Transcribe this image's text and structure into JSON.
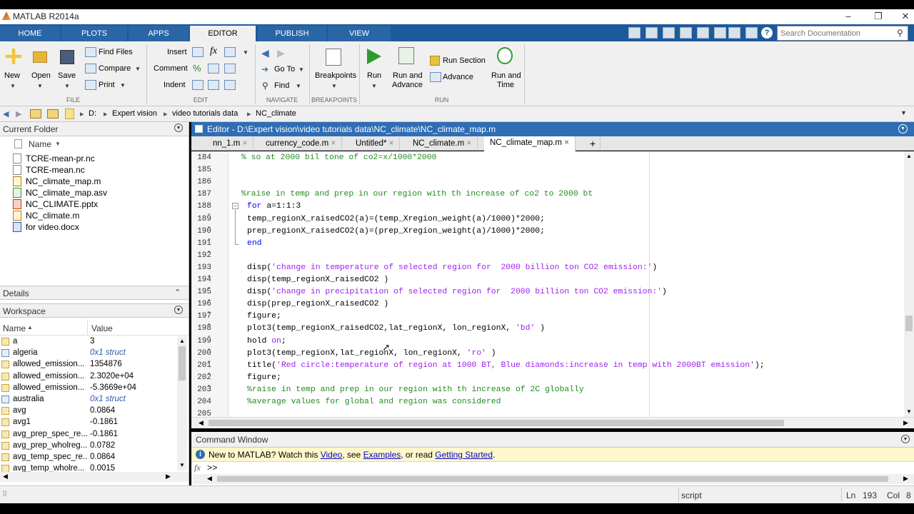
{
  "window": {
    "title": "MATLAB R2014a"
  },
  "tabs": [
    "HOME",
    "PLOTS",
    "APPS",
    "EDITOR",
    "PUBLISH",
    "VIEW"
  ],
  "search": {
    "placeholder": "Search Documentation"
  },
  "ribbon": {
    "file": {
      "new": "New",
      "open": "Open",
      "save": "Save",
      "find_files": "Find Files",
      "compare": "Compare",
      "print": "Print",
      "section": "FILE"
    },
    "edit": {
      "insert": "Insert",
      "comment": "Comment",
      "indent": "Indent",
      "fx": "fx",
      "section": "EDIT"
    },
    "navigate": {
      "go_to": "Go To",
      "find": "Find",
      "section": "NAVIGATE"
    },
    "breakpoints": {
      "label": "Breakpoints",
      "section": "BREAKPOINTS"
    },
    "run": {
      "run": "Run",
      "run_and_advance_1": "Run and",
      "run_and_advance_2": "Advance",
      "run_section": "Run Section",
      "advance": "Advance",
      "run_and_time_1": "Run and",
      "run_and_time_2": "Time",
      "section": "RUN"
    }
  },
  "address": {
    "path": [
      "D:",
      "Expert vision",
      "video tutorials data",
      "NC_climate"
    ]
  },
  "current_folder": {
    "title": "Current Folder",
    "column": "Name",
    "files": [
      "TCRE-mean-pr.nc",
      "TCRE-mean.nc",
      "NC_climate_map.m",
      "NC_climate_map.asv",
      "NC_CLIMATE.pptx",
      "NC_climate.m",
      "for video.docx"
    ]
  },
  "details": {
    "title": "Details"
  },
  "workspace": {
    "title": "Workspace",
    "col_name": "Name",
    "col_value": "Value",
    "rows": [
      {
        "name": "a",
        "value": "3"
      },
      {
        "name": "algeria",
        "value": "0x1 struct"
      },
      {
        "name": "allowed_emission...",
        "value": "1354876"
      },
      {
        "name": "allowed_emission...",
        "value": "2.3020e+04"
      },
      {
        "name": "allowed_emission...",
        "value": "-5.3669e+04"
      },
      {
        "name": "australia",
        "value": "0x1 struct"
      },
      {
        "name": "avg",
        "value": "0.0864"
      },
      {
        "name": "avg1",
        "value": "-0.1861"
      },
      {
        "name": "avg_prep_spec_re...",
        "value": "-0.1861"
      },
      {
        "name": "avg_prep_wholreg...",
        "value": "0.0782"
      },
      {
        "name": "avg_temp_spec_re...",
        "value": "0.0864"
      },
      {
        "name": "avg_temp_wholre...",
        "value": "0.0015"
      }
    ]
  },
  "editor": {
    "title": "Editor - D:\\Expert vision\\video tutorials data\\NC_climate\\NC_climate_map.m",
    "tabs": [
      "nn_1.m",
      "currency_code.m",
      "Untitled*",
      "NC_climate.m",
      "NC_climate_map.m"
    ],
    "add_tab": "+",
    "lines": [
      {
        "n": "184",
        "t": "% so at 2000 bil tone of co2=x/1000*2000",
        "c": "cm",
        "i": 0
      },
      {
        "n": "185",
        "t": "",
        "c": "",
        "i": 0
      },
      {
        "n": "186",
        "t": "",
        "c": "",
        "i": 0
      },
      {
        "n": "187",
        "t": "%raise in temp and prep in our region with th increase of co2 to 2000 bt",
        "c": "cm",
        "i": 0
      },
      {
        "n": "188 -",
        "t": "for a=1:1:3",
        "c": "for",
        "i": 1
      },
      {
        "n": "189 -",
        "t": "temp_regionX_raisedCO2(a)=(temp_Xregion_weight(a)/1000)*2000;",
        "c": "",
        "i": 1
      },
      {
        "n": "190 -",
        "t": "prep_regionX_raisedCO2(a)=(prep_Xregion_weight(a)/1000)*2000;",
        "c": "",
        "i": 1
      },
      {
        "n": "191 -",
        "t": "end",
        "c": "kw",
        "i": 1
      },
      {
        "n": "192",
        "t": "",
        "c": "",
        "i": 0
      },
      {
        "n": "193 -",
        "t": "disp('change in temperature of selected region for  2000 billion ton CO2 emission:')",
        "c": "str",
        "i": 1
      },
      {
        "n": "194 -",
        "t": "disp(temp_regionX_raisedCO2 )",
        "c": "",
        "i": 1
      },
      {
        "n": "195 -",
        "t": "disp('change in precipitation of selected region for  2000 billion ton CO2 emission:')",
        "c": "str",
        "i": 1
      },
      {
        "n": "196 -",
        "t": "disp(prep_regionX_raisedCO2 )",
        "c": "",
        "i": 1
      },
      {
        "n": "197 -",
        "t": "figure;",
        "c": "",
        "i": 1
      },
      {
        "n": "198 -",
        "t": "plot3(temp_regionX_raisedCO2,lat_regionX, lon_regionX, 'bd' )",
        "c": "str",
        "i": 1
      },
      {
        "n": "199 -",
        "t": "hold on;",
        "c": "hold",
        "i": 1
      },
      {
        "n": "200 -",
        "t": "plot3(temp_regionX,lat_regionX, lon_regionX, 'ro' )",
        "c": "str",
        "i": 1
      },
      {
        "n": "201 -",
        "t": "title('Red circle:temperature of region at 1000 BT, Blue diamonds:increase in temp with 2000BT emission');",
        "c": "str",
        "i": 1
      },
      {
        "n": "202 -",
        "t": "figure;",
        "c": "",
        "i": 1
      },
      {
        "n": "203",
        "t": "%raise in temp and prep in our region with th increase of 2C globally",
        "c": "cm",
        "i": 1
      },
      {
        "n": "204",
        "t": "%average values for global and region was considered",
        "c": "cm",
        "i": 1
      },
      {
        "n": "205",
        "t": "",
        "c": "",
        "i": 0
      }
    ]
  },
  "command_window": {
    "title": "Command Window",
    "banner_prefix": "New to MATLAB? Watch this ",
    "banner_video": "Video",
    "banner_mid": ", see ",
    "banner_examples": "Examples",
    "banner_mid2": ", or read ",
    "banner_started": "Getting Started",
    "banner_end": ".",
    "prompt": ">>",
    "fx": "fx"
  },
  "status": {
    "mode": "script",
    "ln_label": "Ln",
    "ln": "193",
    "col_label": "Col",
    "col": "8"
  },
  "colors": {
    "accent": "#1c5a9b",
    "editor_header": "#2f6db5",
    "comment": "#228b22",
    "keyword": "#0000ff",
    "string": "#a020f0"
  }
}
